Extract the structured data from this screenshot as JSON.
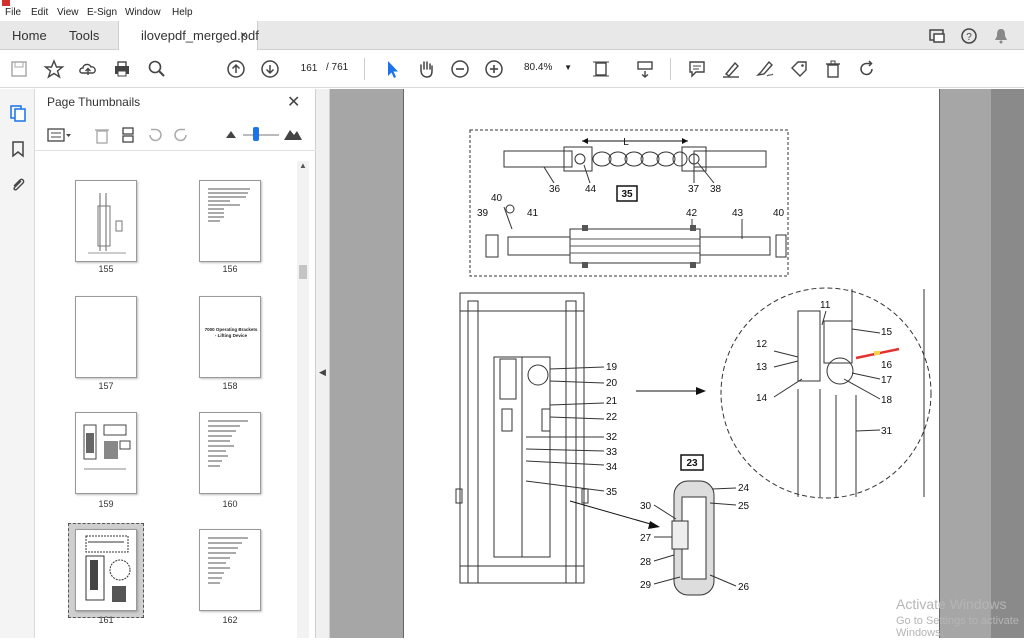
{
  "menu": {
    "items": [
      "File",
      "Edit",
      "View",
      "E-Sign",
      "Window",
      "Help"
    ]
  },
  "tabs": {
    "home": "Home",
    "tools": "Tools",
    "document": "ilovepdf_merged.pdf",
    "close": "×"
  },
  "toolbar": {
    "current_page": "161",
    "total_pages": "/ 761",
    "zoom": "80.4%"
  },
  "panel": {
    "title": "Page Thumbnails",
    "close": "✕",
    "thumbnails": [
      {
        "label": "155"
      },
      {
        "label": "156"
      },
      {
        "label": "157"
      },
      {
        "label": "158",
        "text": "7000 Operating Brackets - Lifting Device"
      },
      {
        "label": "159"
      },
      {
        "label": "160"
      },
      {
        "label": "161",
        "selected": true
      },
      {
        "label": "162"
      }
    ]
  },
  "drawing": {
    "detail35": "35",
    "detail23": "23",
    "dim_L": "L",
    "callouts_top": [
      "36",
      "44",
      "37",
      "38",
      "39",
      "40",
      "41",
      "42",
      "43",
      "40"
    ],
    "callouts_mid": [
      "19",
      "20",
      "21",
      "22",
      "32",
      "33",
      "34",
      "35"
    ],
    "callouts_circle": [
      "11",
      "15",
      "12",
      "13",
      "16",
      "17",
      "14",
      "18",
      "31"
    ],
    "callouts_section": [
      "24",
      "25",
      "30",
      "27",
      "28",
      "29",
      "26"
    ]
  },
  "watermark": {
    "line1": "Activate Windows",
    "line2": "Go to Settings to activate Windows."
  },
  "colors": {
    "accent": "#1a73e8",
    "tab_bg": "#e8e8e8",
    "doc_bg": "#a6a6a6",
    "red_line": "#e53030"
  }
}
